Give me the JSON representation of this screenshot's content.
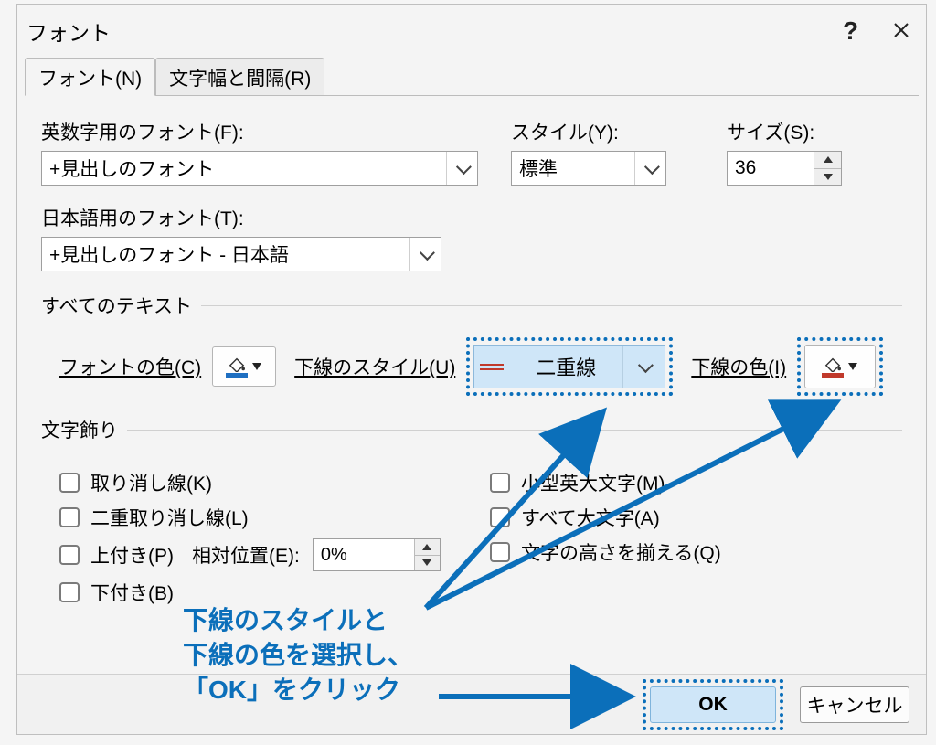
{
  "titlebar": {
    "title": "フォント"
  },
  "tabs": {
    "font": "フォント(N)",
    "spacing": "文字幅と間隔(R)"
  },
  "labels": {
    "latin_font": "英数字用のフォント(F):",
    "style": "スタイル(Y):",
    "size": "サイズ(S):",
    "asian_font": "日本語用のフォント(T):",
    "all_text": "すべてのテキスト",
    "font_color": "フォントの色(C)",
    "underline_style": "下線のスタイル(U)",
    "underline_color": "下線の色(I)",
    "decor": "文字飾り",
    "rel_pos": "相対位置(E):"
  },
  "values": {
    "latin_font": "+見出しのフォント",
    "asian_font": "+見出しのフォント - 日本語",
    "style": "標準",
    "size": "36",
    "underline_style": "二重線",
    "rel_pos": "0%"
  },
  "checks": {
    "strike": "取り消し線(K)",
    "dstrike": "二重取り消し線(L)",
    "sup": "上付き(P)",
    "sub": "下付き(B)",
    "smallcaps": "小型英大文字(M)",
    "allcaps": "すべて大文字(A)",
    "eqheight": "文字の高さを揃える(Q)"
  },
  "footer": {
    "ok": "OK",
    "cancel": "キャンセル"
  },
  "annotation": {
    "l1": "下線のスタイルと",
    "l2": "下線の色を選択し、",
    "l3": "「OK」をクリック"
  }
}
